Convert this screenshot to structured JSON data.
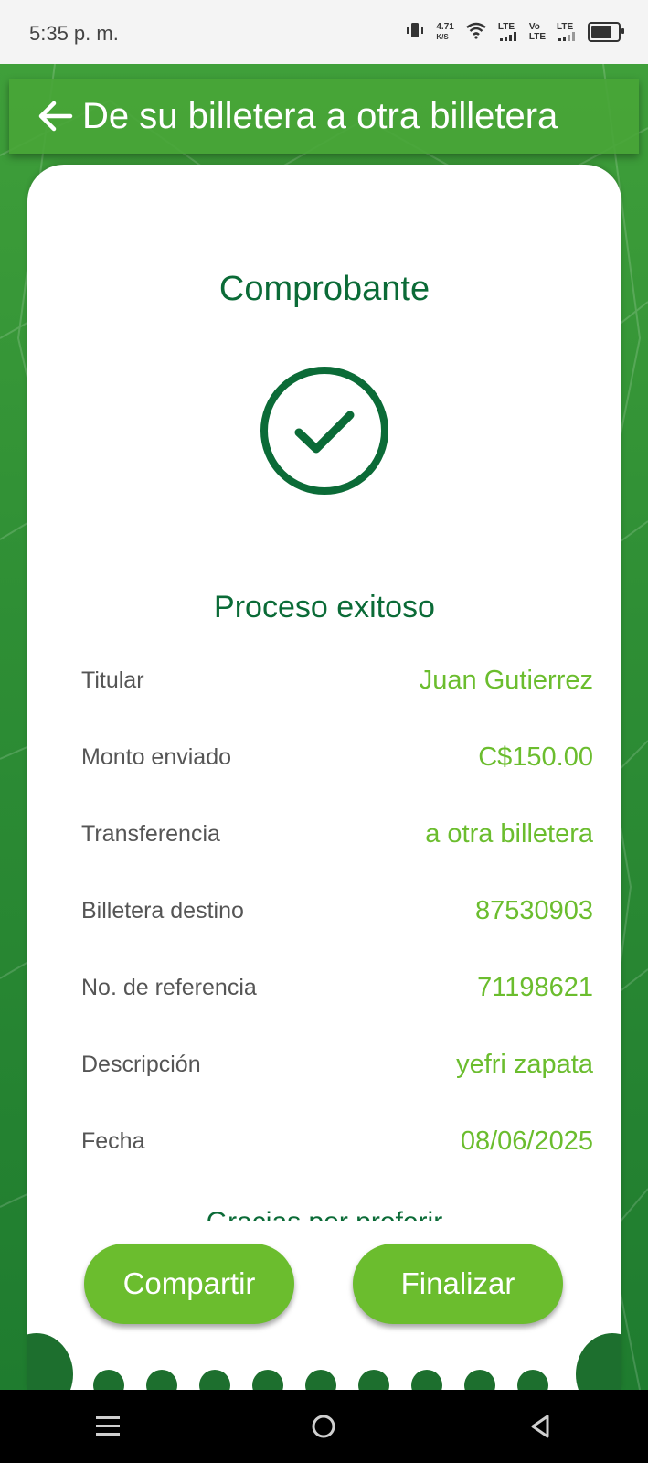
{
  "status_bar": {
    "time": "5:35 p. m.",
    "net_speed_value": "4.71",
    "net_speed_unit": "K/S",
    "lte1": "LTE",
    "volte_top": "Vo",
    "volte_bottom": "LTE",
    "lte2": "LTE"
  },
  "header": {
    "title": "De su billetera a otra billetera"
  },
  "receipt": {
    "title": "Comprobante",
    "status": "Proceso exitoso",
    "thanks": "Gracias por preferir",
    "details": [
      {
        "label": "Titular",
        "value": "Juan Gutierrez"
      },
      {
        "label": "Monto enviado",
        "value": "C$150.00"
      },
      {
        "label": "Transferencia",
        "value": "a otra billetera"
      },
      {
        "label": "Billetera destino",
        "value": "87530903"
      },
      {
        "label": "No. de referencia",
        "value": "71198621"
      },
      {
        "label": "Descripción",
        "value": "yefri zapata"
      },
      {
        "label": "Fecha",
        "value": "08/06/2025"
      }
    ]
  },
  "actions": {
    "share_label": "Compartir",
    "finish_label": "Finalizar"
  },
  "colors": {
    "brand_dark": "#0b6b37",
    "accent": "#6bbd2e",
    "background_green": "#2f8f35"
  },
  "icons": [
    "back-arrow-icon",
    "check-circle-icon",
    "vibrate-icon",
    "wifi-icon",
    "battery-icon",
    "menu-icon",
    "home-icon",
    "back-icon"
  ]
}
